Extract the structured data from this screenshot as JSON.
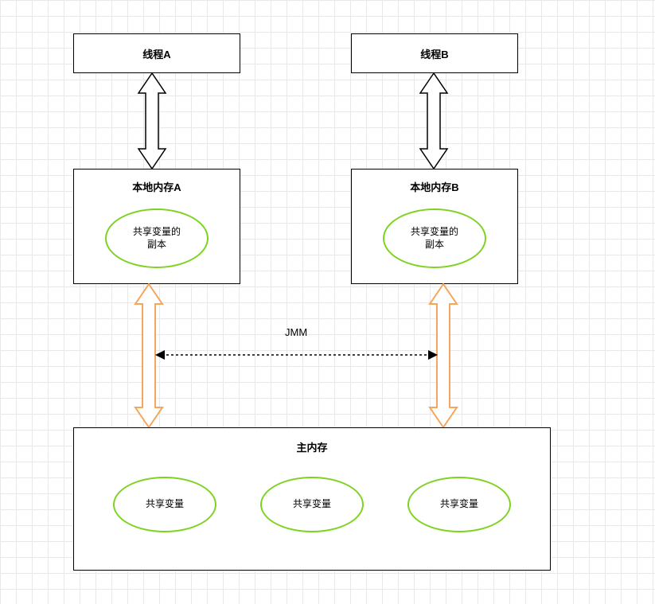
{
  "threadA": {
    "label": "线程A"
  },
  "threadB": {
    "label": "线程B"
  },
  "localMemA": {
    "title": "本地内存A",
    "copyLabel": "共享变量的\n副本"
  },
  "localMemB": {
    "title": "本地内存B",
    "copyLabel": "共享变量的\n副本"
  },
  "jmm": {
    "label": "JMM"
  },
  "mainMemory": {
    "title": "主内存",
    "vars": [
      "共享变量",
      "共享变量",
      "共享变量"
    ]
  }
}
